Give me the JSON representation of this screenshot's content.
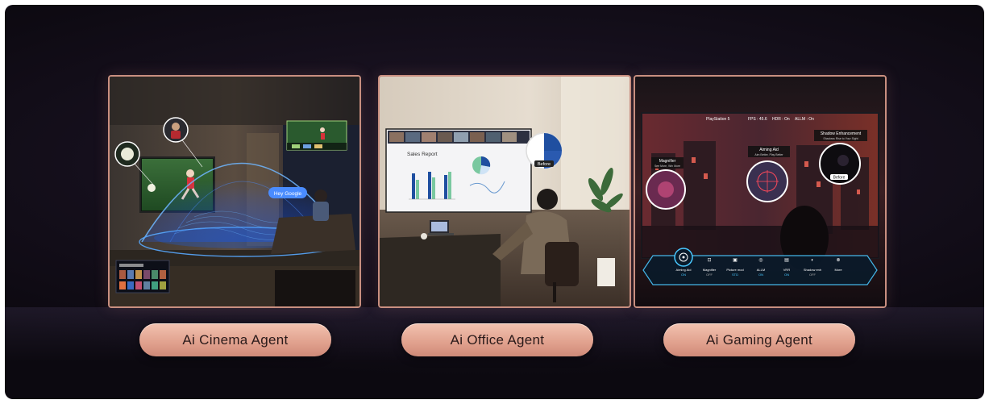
{
  "agents": [
    {
      "label": "Ai Cinema Agent"
    },
    {
      "label": "Ai Office Agent"
    },
    {
      "label": "Ai Gaming Agent"
    }
  ],
  "cinema": {
    "voice_bubble": "Hey Google"
  },
  "office": {
    "report_title": "Sales Report",
    "before_tag": "Before"
  },
  "gaming": {
    "hud_platform": "PlayStation 5",
    "hud_fps": "FPS : 45.6",
    "hud_hdr": "HDR : On",
    "hud_allm": "ALLM : On",
    "magnifier_title": "Magnifier",
    "magnifier_sub": "See More, Win More",
    "aiming_title": "Aiming Aid",
    "aiming_sub": "Aim Better, Play Better",
    "shadow_title": "Shadow Enhancement",
    "shadow_sub": "Shadows Rise to Your Sight",
    "before_tag": "Before",
    "menu": [
      {
        "label": "Aiming Aid",
        "state": "ON",
        "icon": "crosshair-icon"
      },
      {
        "label": "Magnifier",
        "state": "OFF",
        "icon": "magnifier-icon"
      },
      {
        "label": "Picture mod",
        "state": "STD",
        "icon": "picture-icon"
      },
      {
        "label": "ALLM",
        "state": "ON",
        "icon": "allm-icon"
      },
      {
        "label": "VRR",
        "state": "ON",
        "icon": "vrr-icon"
      },
      {
        "label": "Shadow enh",
        "state": "OFF",
        "icon": "shadow-icon"
      },
      {
        "label": "More",
        "state": "",
        "icon": "more-icon"
      }
    ]
  },
  "colors": {
    "button_top": "#f2c2b0",
    "button_bottom": "#cf8a78",
    "card_border": "#c98f80",
    "hud_cyan": "#49c8ff",
    "background": "#150f1c"
  }
}
